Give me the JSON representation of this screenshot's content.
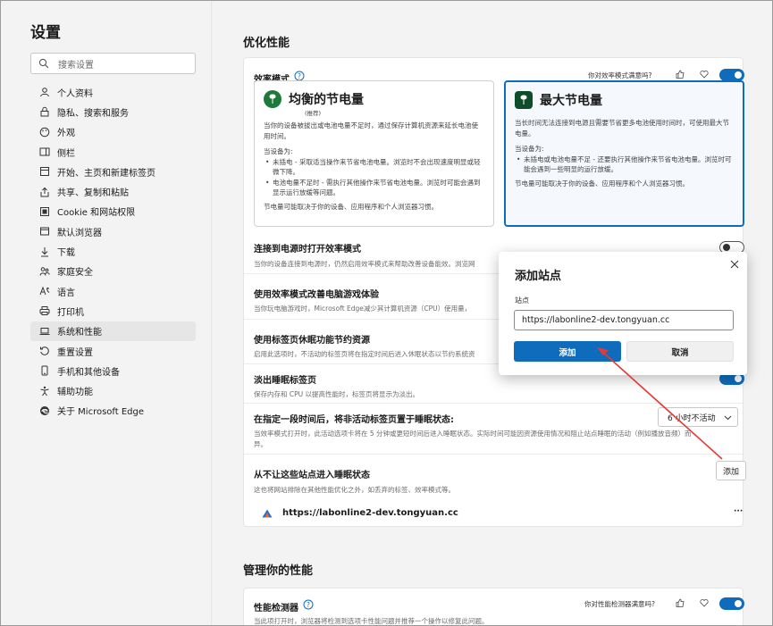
{
  "sidebar": {
    "title": "设置",
    "search_placeholder": "搜索设置",
    "items": [
      {
        "label": "个人资料",
        "icon": "profile-icon"
      },
      {
        "label": "隐私、搜索和服务",
        "icon": "lock-icon"
      },
      {
        "label": "外观",
        "icon": "palette-icon"
      },
      {
        "label": "侧栏",
        "icon": "sidebar-icon"
      },
      {
        "label": "开始、主页和新建标签页",
        "icon": "home-icon"
      },
      {
        "label": "共享、复制和粘贴",
        "icon": "share-icon"
      },
      {
        "label": "Cookie 和网站权限",
        "icon": "cookie-icon"
      },
      {
        "label": "默认浏览器",
        "icon": "browser-icon"
      },
      {
        "label": "下载",
        "icon": "download-icon"
      },
      {
        "label": "家庭安全",
        "icon": "family-icon"
      },
      {
        "label": "语言",
        "icon": "language-icon"
      },
      {
        "label": "打印机",
        "icon": "printer-icon"
      },
      {
        "label": "系统和性能",
        "icon": "laptop-icon"
      },
      {
        "label": "重置设置",
        "icon": "reset-icon"
      },
      {
        "label": "手机和其他设备",
        "icon": "phone-icon"
      },
      {
        "label": "辅助功能",
        "icon": "accessibility-icon"
      },
      {
        "label": "关于 Microsoft Edge",
        "icon": "edge-icon"
      }
    ]
  },
  "optimize": {
    "section_title": "优化性能",
    "efficiency": {
      "title": "效率模式",
      "feedback": "你对效率模式满意吗?",
      "enabled": true,
      "balanced": {
        "name": "均衡的节电量",
        "recommended": "(推荐)",
        "desc": "当你的设备被拔出或电池电量不足时，通过保存计算机资源来延长电池使用时间。",
        "when_label": "当设备为:",
        "bullet1": "未插电 - 采取适当操作来节省电池电量。浏览时不会出现速度明显或轻微下降。",
        "bullet2": "电池电量不足时 - 需执行其他操作来节省电池电量。浏览时可能会遇到显示运行放缓等问题。",
        "note": "节电量可能取决于你的设备、应用程序和个人浏览器习惯。"
      },
      "max": {
        "name": "最大节电量",
        "desc": "当长时间无法连接到电源且需要节省更多电池使用时间时，可使用最大节电量。",
        "when_label": "当设备为:",
        "bullet1": "未插电或电池电量不足 - 还要执行其他操作来节省电池电量。浏览时可能会遇到一些明显的运行放缓。",
        "note": "节电量可能取决于你的设备、应用程序和个人浏览器习惯。"
      }
    },
    "power_connect": {
      "title": "连接到电源时打开效率模式",
      "desc": "当你的设备连接到电源时，仍然启用效率模式来帮助改善设备能效。浏览网",
      "enabled": false
    },
    "gaming": {
      "title": "使用效率模式改善电脑游戏体验",
      "desc": "当你玩电脑游戏时，Microsoft Edge减少其计算机资源（CPU）使用量，"
    },
    "sleeping_tabs": {
      "title": "使用标签页休眠功能节约资源",
      "desc": "启用此选项时，不活动的标签页将在指定时间后进入休眠状态以节约系统资"
    },
    "fade": {
      "title": "淡出睡眠标签页",
      "desc": "保存内存和 CPU 以提高性能时，标签页将显示为淡出。"
    },
    "inactive": {
      "title": "在指定一段时间后，将非活动标签页置于睡眠状态:",
      "desc_line1": "当效率模式打开时，此活动选项卡将在 5 分钟或更短时间后进入睡眠状态。实际时间可能因资源使用情况和阻止站点睡眠的活动（例如播放音频）而",
      "desc_line2": "异。",
      "dropdown": "6 小时不活动"
    },
    "never_sleep": {
      "title": "从不让这些站点进入睡眠状态",
      "desc": "这也将网站排除在其他性能优化之外，如丢弃的标签、效率模式等。",
      "add_label": "添加",
      "site": "https://labonline2-dev.tongyuan.cc",
      "more": "···"
    }
  },
  "manage": {
    "section_title": "管理你的性能",
    "detector": {
      "title": "性能检测器",
      "feedback": "你对性能检测器满意吗?",
      "desc": "当此项打开时，浏览器将检测到选项卡性能问题并推荐一个操作以修复此问题。",
      "enabled": true
    }
  },
  "dialog": {
    "title": "添加站点",
    "label": "站点",
    "value": "https://labonline2-dev.tongyuan.cc",
    "add": "添加",
    "cancel": "取消"
  },
  "colors": {
    "accent": "#0f6cbd",
    "annotation": "#e53935"
  }
}
